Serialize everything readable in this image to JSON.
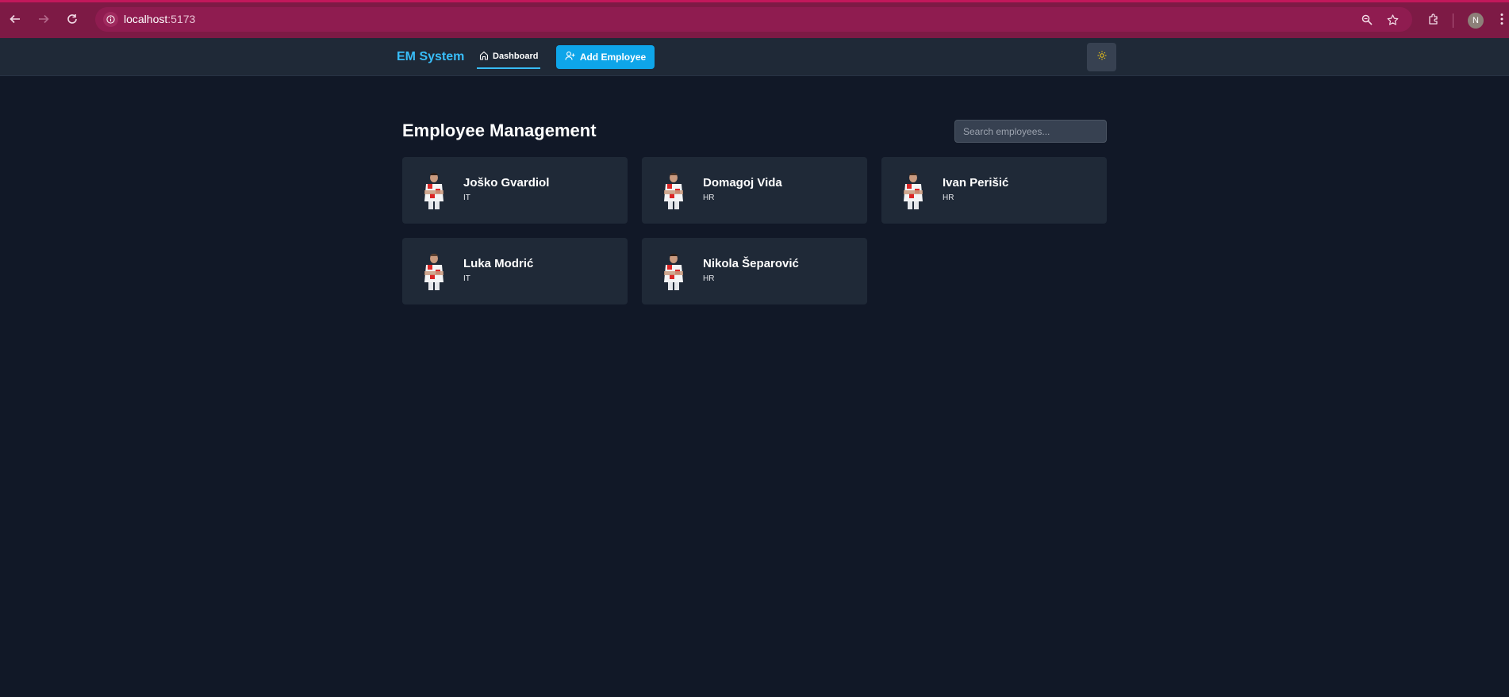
{
  "browser": {
    "url_host": "localhost",
    "url_port": ":5173",
    "profile_initial": "N"
  },
  "nav": {
    "brand": "EM System",
    "dashboard_label": "Dashboard",
    "add_employee_label": "Add Employee"
  },
  "main": {
    "title": "Employee Management",
    "search_placeholder": "Search employees..."
  },
  "employees": [
    {
      "name": "Joško Gvardiol",
      "department": "IT"
    },
    {
      "name": "Domagoj Vida",
      "department": "HR"
    },
    {
      "name": "Ivan Perišić",
      "department": "HR"
    },
    {
      "name": "Luka Modrić",
      "department": "IT"
    },
    {
      "name": "Nikola Šeparović",
      "department": "HR"
    }
  ],
  "icons": {
    "back": "arrow-left-icon",
    "forward": "arrow-right-icon",
    "reload": "reload-icon",
    "site_info": "info-icon",
    "zoom": "zoom-icon",
    "bookmark": "star-icon",
    "extensions": "puzzle-icon",
    "menu": "kebab-menu-icon",
    "dashboard": "home-icon",
    "add_employee": "user-plus-icon",
    "theme": "sun-icon"
  },
  "colors": {
    "background": "#111827",
    "card": "#1f2937",
    "accent": "#0ea5e9",
    "brand": "#38bdf8",
    "browser_frame": "#7d1a45"
  }
}
